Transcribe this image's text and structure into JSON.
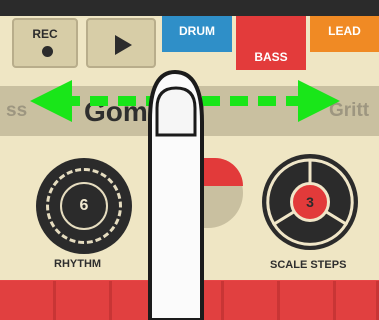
{
  "transport": {
    "rec_label": "REC",
    "play_icon": "play-icon"
  },
  "tabs": [
    {
      "label": "DRUM",
      "color": "#2f8fc8"
    },
    {
      "label": "BASS",
      "color": "#e33b3b",
      "selected": true
    },
    {
      "label": "LEAD",
      "color": "#f08a24"
    }
  ],
  "preset": {
    "prev": "ss",
    "current": "Gom   and",
    "next": "Gritt"
  },
  "dials": {
    "rhythm": {
      "value": "6",
      "label": "RHYTHM"
    },
    "scale_steps": {
      "value": "3",
      "label": "SCALE STEPS"
    }
  },
  "overlay": {
    "gesture": "swipe-left-right",
    "arrow_color": "#19e619"
  }
}
